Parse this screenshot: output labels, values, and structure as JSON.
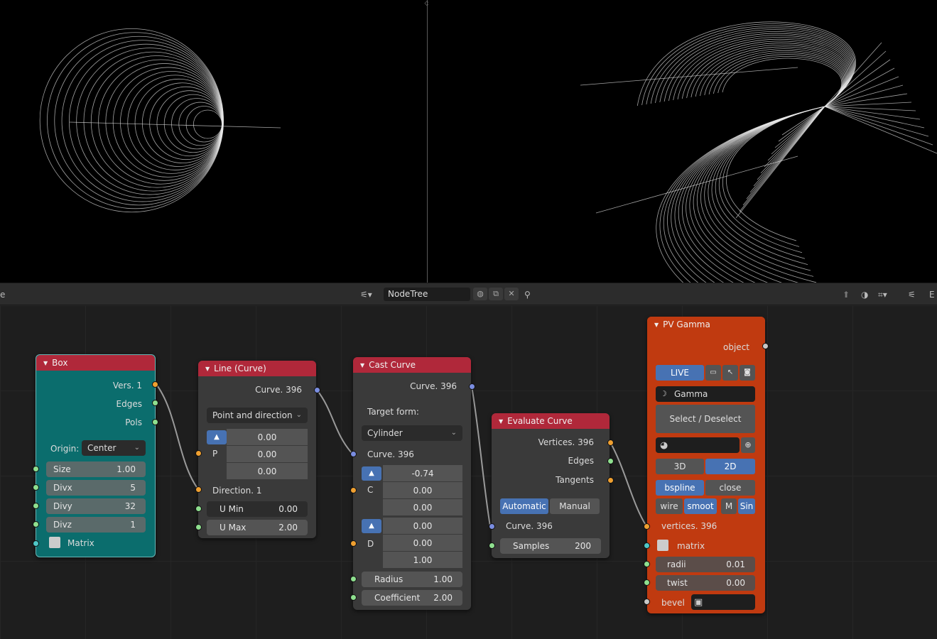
{
  "header": {
    "tree_name": "NodeTree",
    "left_label": "e",
    "right_label": "E"
  },
  "nodes": {
    "box": {
      "title": "Box",
      "out_verts": "Vers. 1",
      "out_edges": "Edges",
      "out_pols": "Pols",
      "origin_label": "Origin:",
      "origin_value": "Center",
      "size_label": "Size",
      "size_value": "1.00",
      "divx_label": "Divx",
      "divx_value": "5",
      "divy_label": "Divy",
      "divy_value": "32",
      "divz_label": "Divz",
      "divz_value": "1",
      "matrix_label": "Matrix"
    },
    "line": {
      "title": "Line (Curve)",
      "out_curve": "Curve. 396",
      "mode": "Point and direction",
      "p_label": "P",
      "p_values": [
        "0.00",
        "0.00",
        "0.00"
      ],
      "direction_label": "Direction. 1",
      "umin_label": "U Min",
      "umin_value": "0.00",
      "umax_label": "U Max",
      "umax_value": "2.00"
    },
    "cast": {
      "title": "Cast Curve",
      "out_curve": "Curve. 396",
      "target_label": "Target form:",
      "target_value": "Cylinder",
      "in_curve": "Curve. 396",
      "c_label": "C",
      "c_values": [
        "-0.74",
        "0.00",
        "0.00"
      ],
      "d_label": "D",
      "d_values": [
        "0.00",
        "0.00",
        "1.00"
      ],
      "radius_label": "Radius",
      "radius_value": "1.00",
      "coef_label": "Coefficient",
      "coef_value": "2.00"
    },
    "evaluate": {
      "title": "Evaluate Curve",
      "out_vertices": "Vertices. 396",
      "out_edges": "Edges",
      "out_tangents": "Tangents",
      "mode_auto": "Automatic",
      "mode_manual": "Manual",
      "in_curve": "Curve. 396",
      "samples_label": "Samples",
      "samples_value": "200"
    },
    "gamma": {
      "title": "PV Gamma",
      "out_object": "object",
      "live_label": "LIVE",
      "gamma_label": "Gamma",
      "select_label": "Select / Deselect",
      "btn_3d": "3D",
      "btn_2d": "2D",
      "btn_bspline": "bspline",
      "btn_close": "close",
      "btn_wire": "wire",
      "btn_smooth": "smoot",
      "btn_m": "M",
      "btn_sin": "Sin",
      "in_vertices": "vertices. 396",
      "in_matrix": "matrix",
      "radii_label": "radii",
      "radii_value": "0.01",
      "twist_label": "twist",
      "twist_value": "0.00",
      "bevel_label": "bevel"
    }
  },
  "colors": {
    "node_header": "#b0283a",
    "box_body": "#0b6d6d",
    "gamma_body": "#c03a10",
    "toggle_on": "#4772b3"
  },
  "icons": [
    "node-tree-icon",
    "shield-icon",
    "duplicate-icon",
    "close-icon",
    "pin-icon",
    "monitor-icon",
    "cursor-icon",
    "camera-icon",
    "sphere-icon",
    "plus-icon",
    "arrow-up-icon"
  ]
}
